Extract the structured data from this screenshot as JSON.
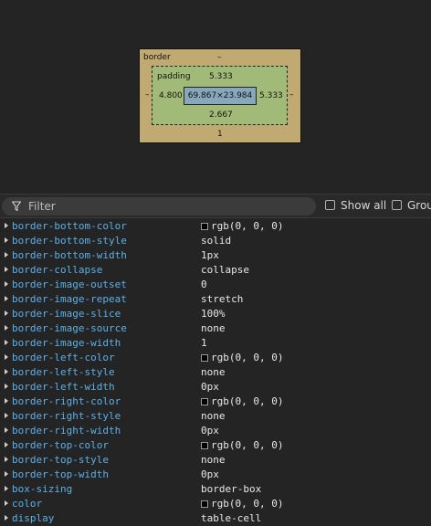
{
  "box_model": {
    "border_label": "border",
    "border_top": "–",
    "border_bottom": "1",
    "padding_label": "padding",
    "padding_top": "5.333",
    "padding_left": "4.800",
    "padding_right": "5.333",
    "padding_bottom": "2.667",
    "margin_left": "–",
    "margin_right": "–",
    "content_size": "69.867×23.984"
  },
  "toolbar": {
    "filter_placeholder": "Filter",
    "show_all_label": "Show all",
    "group_label": "Grou"
  },
  "properties": [
    {
      "name": "border-bottom-color",
      "value": "rgb(0, 0, 0)",
      "swatch": "#000000"
    },
    {
      "name": "border-bottom-style",
      "value": "solid"
    },
    {
      "name": "border-bottom-width",
      "value": "1px"
    },
    {
      "name": "border-collapse",
      "value": "collapse"
    },
    {
      "name": "border-image-outset",
      "value": "0"
    },
    {
      "name": "border-image-repeat",
      "value": "stretch"
    },
    {
      "name": "border-image-slice",
      "value": "100%"
    },
    {
      "name": "border-image-source",
      "value": "none"
    },
    {
      "name": "border-image-width",
      "value": "1"
    },
    {
      "name": "border-left-color",
      "value": "rgb(0, 0, 0)",
      "swatch": "#000000"
    },
    {
      "name": "border-left-style",
      "value": "none"
    },
    {
      "name": "border-left-width",
      "value": "0px"
    },
    {
      "name": "border-right-color",
      "value": "rgb(0, 0, 0)",
      "swatch": "#000000"
    },
    {
      "name": "border-right-style",
      "value": "none"
    },
    {
      "name": "border-right-width",
      "value": "0px"
    },
    {
      "name": "border-top-color",
      "value": "rgb(0, 0, 0)",
      "swatch": "#000000"
    },
    {
      "name": "border-top-style",
      "value": "none"
    },
    {
      "name": "border-top-width",
      "value": "0px"
    },
    {
      "name": "box-sizing",
      "value": "border-box"
    },
    {
      "name": "color",
      "value": "rgb(0, 0, 0)",
      "swatch": "#000000"
    },
    {
      "name": "display",
      "value": "table-cell"
    }
  ]
}
